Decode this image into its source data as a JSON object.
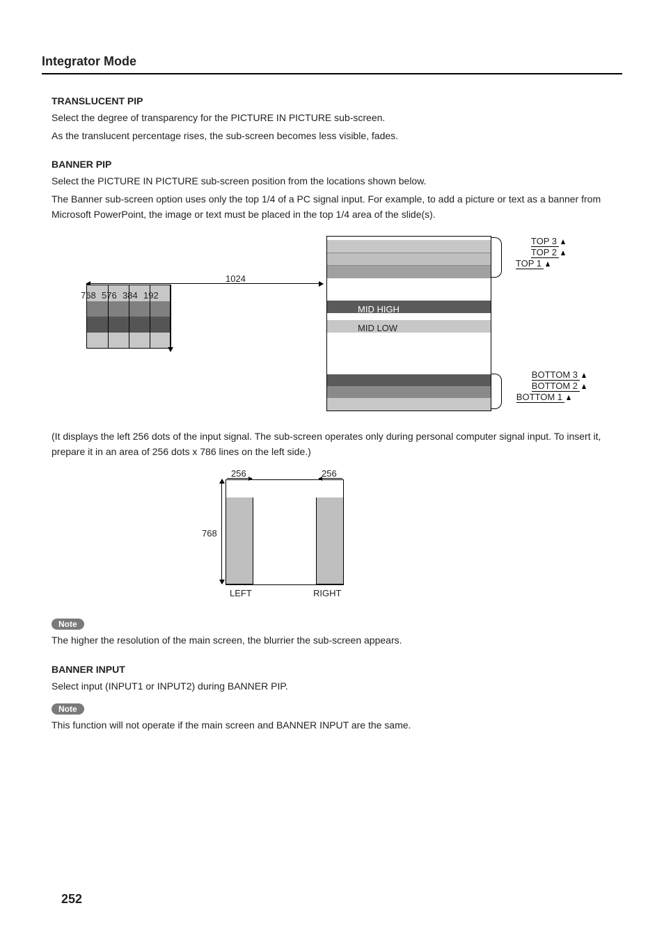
{
  "pageTitle": "Integrator Mode",
  "pageNumber": "252",
  "translucent": {
    "heading": "TRANSLUCENT PIP",
    "p1": "Select the degree of transparency for the PICTURE IN PICTURE sub-screen.",
    "p2": "As the translucent percentage rises, the sub-screen becomes less visible, fades."
  },
  "bannerPip": {
    "heading": "BANNER PIP",
    "p1": "Select the PICTURE IN PICTURE sub-screen position from the locations shown below.",
    "p2": "The Banner sub-screen option uses only the top 1/4 of a PC signal input. For example, to add a picture or text as a banner from Microsoft PowerPoint, the image or text must be placed in the top 1/4 area of the slide(s).",
    "diagram1": {
      "leftWidths": {
        "w768": "768",
        "w576": "576",
        "w384": "384",
        "w192": "192"
      },
      "topWidth": "1024",
      "midHigh": "MID HIGH",
      "midLow": "MID LOW",
      "top1": "TOP 1",
      "top2": "TOP 2",
      "top3": "TOP 3",
      "bottom1": "BOTTOM 1",
      "bottom2": "BOTTOM 2",
      "bottom3": "BOTTOM 3"
    },
    "after1": "(It displays the left 256 dots of the input signal. The sub-screen operates only during personal computer signal input. To insert it, prepare it in an area of 256 dots x 786 lines on the left side.)",
    "diagram2": {
      "l256a": "256",
      "l256b": "256",
      "l768": "768",
      "left": "LEFT",
      "right": "RIGHT"
    }
  },
  "note1": {
    "label": "Note",
    "text": "The higher the resolution of the main screen, the blurrier the sub-screen appears."
  },
  "bannerInput": {
    "heading": "BANNER INPUT",
    "p1": "Select input (INPUT1 or INPUT2) during BANNER PIP."
  },
  "note2": {
    "label": "Note",
    "text": "This function will not operate if the main screen and BANNER INPUT are the same."
  }
}
